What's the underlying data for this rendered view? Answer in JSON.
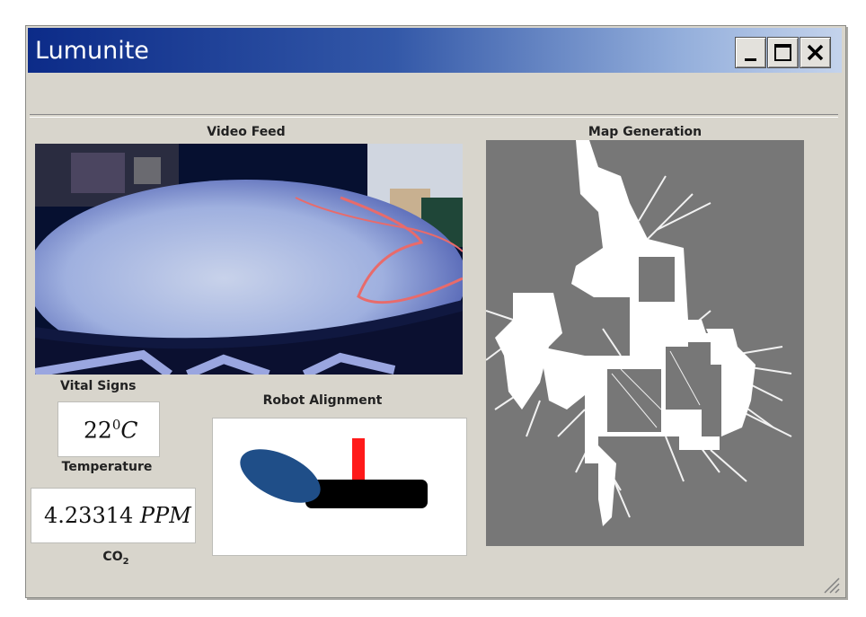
{
  "window": {
    "title": "Lumunite",
    "controls": {
      "minimize": "_",
      "maximize": "□",
      "close": "✕"
    }
  },
  "panels": {
    "video_feed": {
      "label": "Video Feed"
    },
    "map_generation": {
      "label": "Map Generation"
    },
    "vital_signs": {
      "label": "Vital Signs",
      "temperature": {
        "value": "22",
        "unit_sup": "0",
        "unit": "C",
        "label": "Temperature"
      },
      "co2": {
        "value": "4.23314",
        "unit": "PPM",
        "label_main": "CO",
        "label_sub": "2"
      }
    },
    "robot_alignment": {
      "label": "Robot Alignment"
    }
  },
  "colors": {
    "titlebar_start": "#0c2b88",
    "window_bg": "#d8d5cc",
    "map_bg": "#777777",
    "alignment_ellipse": "#1f4e88",
    "alignment_marker": "#ff1a1a",
    "alignment_body": "#000000"
  },
  "icons": [
    "minimize-icon",
    "maximize-icon",
    "close-icon",
    "resize-grip-icon"
  ]
}
